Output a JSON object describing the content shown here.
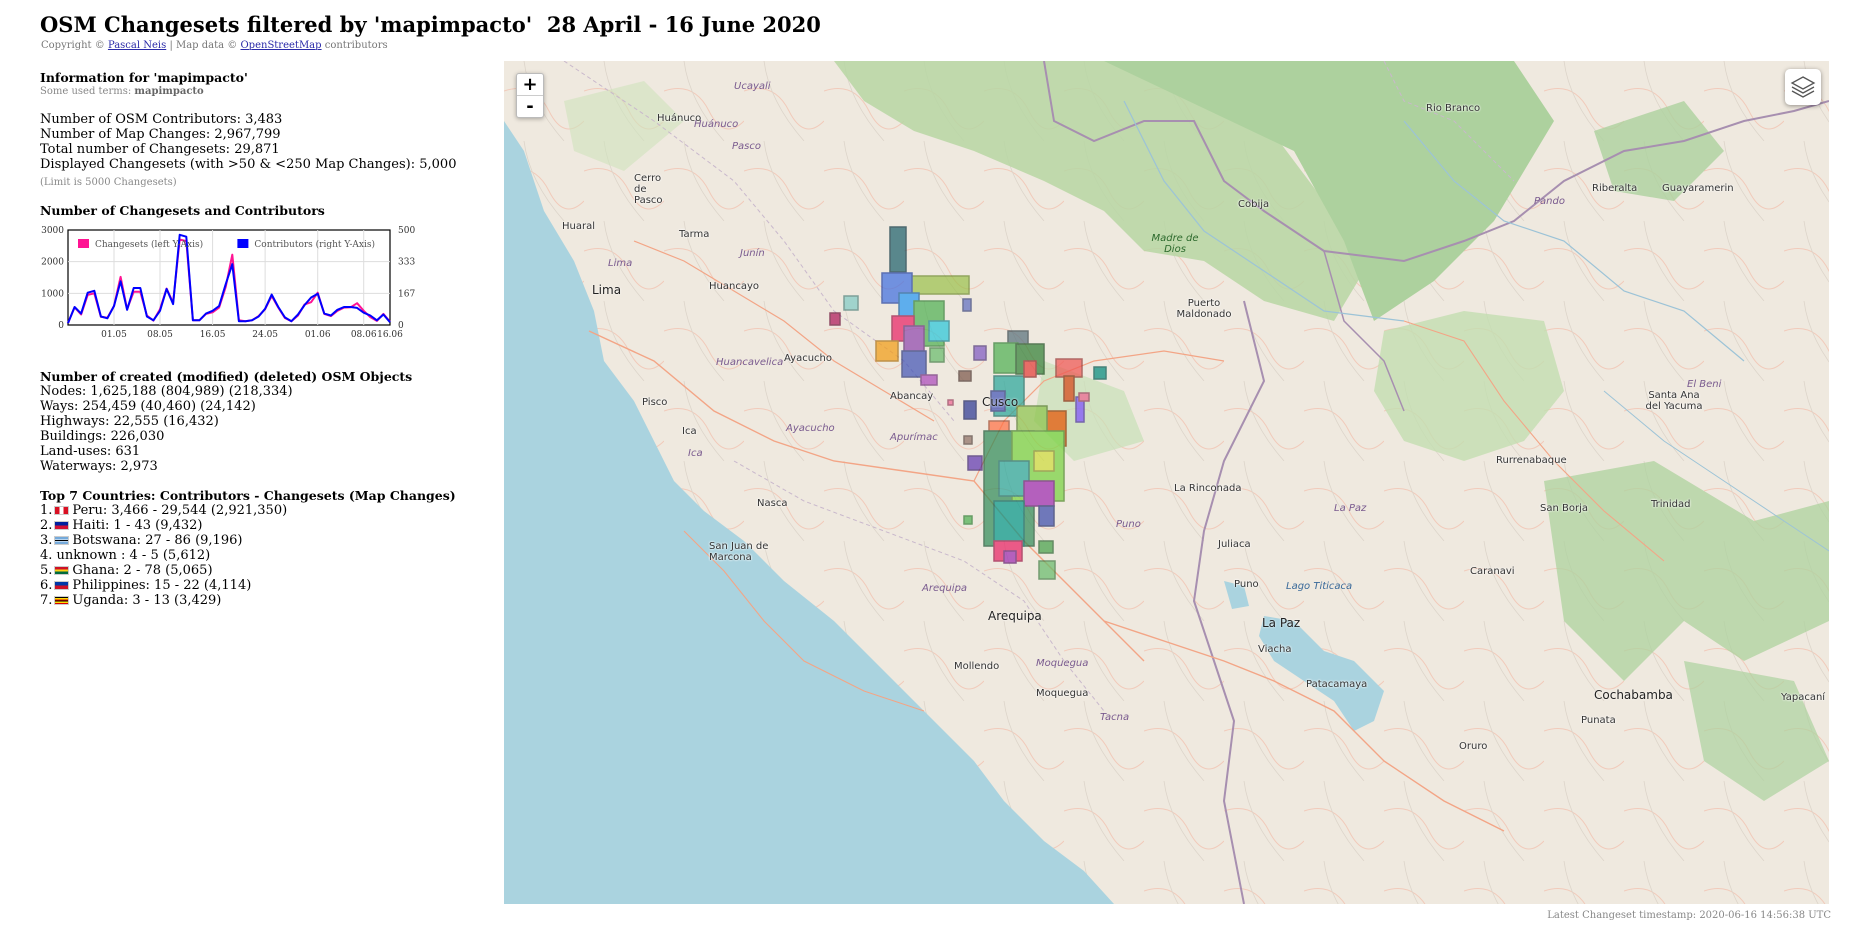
{
  "header": {
    "title": "OSM Changesets filtered by 'mapimpacto'  28 April - 16 June 2020",
    "copyright_prefix": "Copyright ©",
    "copyright_author": "Pascal Neis",
    "copyright_mid": "| Map data ©",
    "copyright_osm": "OpenStreetMap",
    "copyright_suffix": "contributors"
  },
  "info": {
    "heading": "Information for 'mapimpacto'",
    "terms_label": "Some used terms:",
    "terms_value": "mapimpacto",
    "stats": [
      "Number of OSM Contributors: 3,483",
      "Number of Map Changes: 2,967,799",
      "Total number of Changesets: 29,871",
      "Displayed Changesets (with >50 & <250 Map Changes): 5,000"
    ],
    "limit_note": "(Limit is 5000 Changesets)"
  },
  "chart_section": {
    "heading": "Number of Changesets and Contributors"
  },
  "chart_data": {
    "type": "line",
    "x_ticks": [
      "01.05",
      "08.05",
      "16.05",
      "24.05",
      "01.06",
      "08.06",
      "16.06"
    ],
    "y_left_ticks": [
      "3000",
      "2000",
      "1000",
      "0"
    ],
    "y_right_ticks": [
      "500",
      "333",
      "167",
      "0"
    ],
    "ylim_left": [
      0,
      3000
    ],
    "ylim_right": [
      0,
      500
    ],
    "grid": true,
    "legend_position": "top-left",
    "series": [
      {
        "name": "Changesets (left Y-Axis)",
        "axis": "left",
        "color": "#ff1493",
        "values": [
          60,
          560,
          330,
          950,
          1000,
          260,
          230,
          600,
          1520,
          500,
          1050,
          1050,
          300,
          140,
          500,
          1150,
          700,
          2700,
          2650,
          150,
          150,
          350,
          400,
          550,
          1200,
          2220,
          150,
          120,
          150,
          280,
          500,
          920,
          550,
          220,
          120,
          300,
          650,
          720,
          1020,
          350,
          280,
          450,
          550,
          560,
          690,
          450,
          250,
          130,
          350,
          100
        ]
      },
      {
        "name": "Contributors (right Y-Axis)",
        "axis": "right",
        "color": "#0000ff",
        "values": [
          10,
          95,
          60,
          170,
          180,
          45,
          35,
          100,
          230,
          80,
          195,
          195,
          45,
          25,
          75,
          190,
          110,
          475,
          465,
          25,
          25,
          60,
          75,
          100,
          215,
          320,
          20,
          20,
          25,
          45,
          85,
          160,
          95,
          40,
          20,
          55,
          105,
          145,
          165,
          60,
          50,
          80,
          95,
          95,
          90,
          65,
          50,
          25,
          55,
          15
        ]
      }
    ]
  },
  "objects": {
    "heading": "Number of created (modified) (deleted) OSM Objects",
    "lines": [
      "Nodes: 1,625,188 (804,989) (218,334)",
      "Ways: 254,459 (40,460) (24,142)",
      "Highways: 22,555 (16,432)",
      "Buildings: 226,030",
      "Land-uses: 631",
      "Waterways: 2,973"
    ]
  },
  "countries": {
    "heading": "Top 7 Countries: Contributors - Changesets (Map Changes)",
    "items": [
      {
        "rank": "1.",
        "text": "Peru: 3,466 - 29,544 (2,921,350)",
        "flag": "peru"
      },
      {
        "rank": "2.",
        "text": "Haiti: 1 - 43 (9,432)",
        "flag": "haiti"
      },
      {
        "rank": "3.",
        "text": "Botswana: 27 - 86 (9,196)",
        "flag": "botswana"
      },
      {
        "rank": "4.",
        "text": "unknown : 4 - 5 (5,612)",
        "flag": ""
      },
      {
        "rank": "5.",
        "text": "Ghana: 2 - 78 (5,065)",
        "flag": "ghana"
      },
      {
        "rank": "6.",
        "text": "Philippines: 15 - 22 (4,114)",
        "flag": "philippines"
      },
      {
        "rank": "7.",
        "text": "Uganda: 3 - 13 (3,429)",
        "flag": "uganda"
      }
    ]
  },
  "map": {
    "zoom_in": "+",
    "zoom_out": "-",
    "cities": [
      {
        "name": "Lima"
      },
      {
        "name": "Arequipa"
      },
      {
        "name": "La Paz"
      },
      {
        "name": "Cochabamba"
      },
      {
        "name": "Cusco"
      }
    ],
    "places": [
      "Huánuco",
      "Cerro de Pasco",
      "Huaral",
      "Tarma",
      "Huancayo",
      "Ayacucho",
      "Abancay",
      "Pisco",
      "Ica",
      "Nasca",
      "San Juan de Marcona",
      "Mollendo",
      "Moquegua",
      "Juliaca",
      "Puno",
      "Viacha",
      "Patacamaya",
      "Punata",
      "Rio Branco",
      "Cobija",
      "Riberalta",
      "Guayaramerin",
      "Puerto Maldonado",
      "Rurrenabaque",
      "San Borja",
      "Trinidad",
      "Santa Ana del Yacuma",
      "La Rinconada",
      "Caranavi",
      "Yapacaní",
      "Oruro",
      "Cerro"
    ],
    "regions": [
      "Ucayali",
      "Huánuco",
      "Pasco",
      "Junín",
      "Lima",
      "Huancavelica",
      "Ayacucho",
      "Apurímac",
      "Ica",
      "Arequipa",
      "Moquegua",
      "Tacna",
      "Puno",
      "La Paz",
      "Pando",
      "El Beni",
      "Madre de Dios"
    ],
    "forest": "Madre de Dios",
    "lake": "Lago Titicaca"
  },
  "footer": {
    "timestamp": "Latest Changeset timestamp: 2020-06-16 14:56:38 UTC"
  }
}
